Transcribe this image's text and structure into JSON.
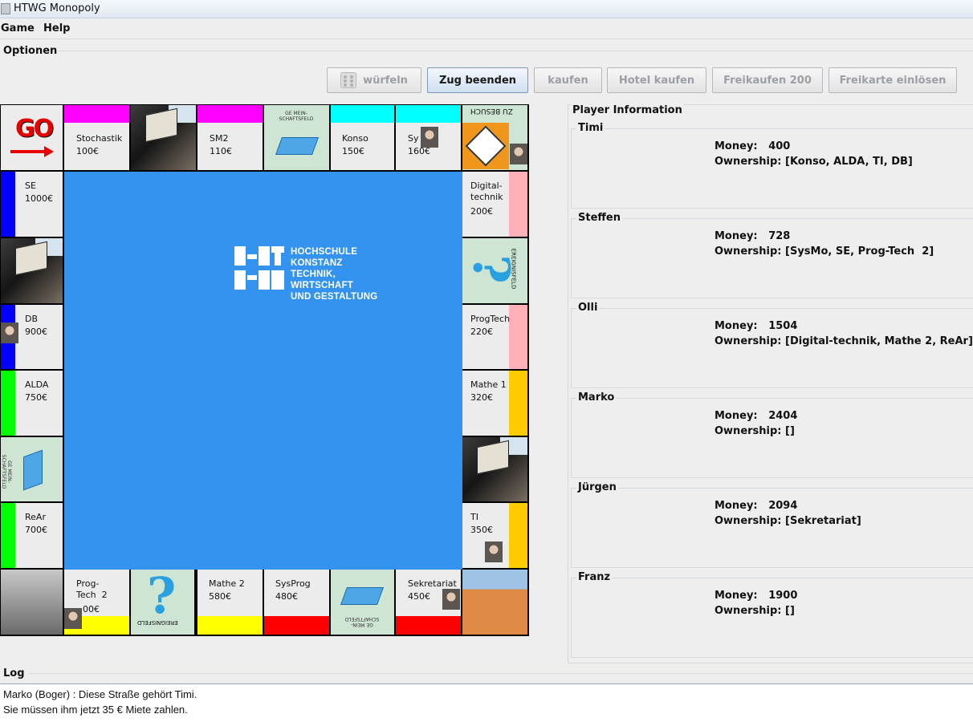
{
  "window": {
    "title": "HTWG Monopoly"
  },
  "menu": {
    "items": [
      "Game",
      "Help"
    ]
  },
  "options": {
    "label": "Optionen",
    "buttons": {
      "roll": "würfeln",
      "end_turn": "Zug beenden",
      "buy": "kaufen",
      "buy_hotel": "Hotel kaufen",
      "buy_free": "Freikaufen 200",
      "redeem_card": "Freikarte einlösen"
    }
  },
  "board": {
    "go": "GO",
    "community_label": "GE MEIN-SCHAFTSFELD",
    "chance_label": "EREIGNISFELD",
    "jail_label": "ZU BESUCH",
    "center_logo": [
      "HOCHSCHULE",
      "KONSTANZ",
      "TECHNIK, WIRTSCHAFT",
      "UND GESTALTUNG"
    ],
    "colors": {
      "center": "#3393ee",
      "magenta": "#ff00ff",
      "cyan": "#00ffff",
      "blue": "#0000ff",
      "green": "#00ff00",
      "pink": "#ffb0b8",
      "orange": "#ffcc00",
      "yellow": "#ffff00",
      "red": "#ff0000"
    },
    "top": [
      {
        "name": "Stochastik",
        "price": "100€"
      },
      {
        "name": "SM2",
        "price": "110€"
      },
      {
        "name": "Konso",
        "price": "150€"
      },
      {
        "name": "Sy",
        "price": "160€"
      }
    ],
    "left": [
      {
        "name": "SE",
        "price": "1000€"
      },
      {
        "name": "DB",
        "price": "900€"
      },
      {
        "name": "ALDA",
        "price": "750€"
      },
      {
        "name": "ReAr",
        "price": "700€"
      }
    ],
    "right": [
      {
        "name": "Digital-\ntechnik",
        "price": "200€"
      },
      {
        "name": "ProgTech",
        "price": "220€"
      },
      {
        "name": "Mathe 1",
        "price": "320€"
      },
      {
        "name": "TI",
        "price": "350€"
      }
    ],
    "bottom": [
      {
        "name": "Prog-\nTech  2",
        "price": "00€"
      },
      {
        "name": "Mathe 2",
        "price": "580€"
      },
      {
        "name": "SysProg",
        "price": "480€"
      },
      {
        "name": "Sekretariat",
        "price": "450€"
      }
    ]
  },
  "player_info": {
    "label": "Player Information",
    "players": [
      {
        "name": "Timi",
        "money": "Money:   400",
        "ownership": "Ownership: [Konso, ALDA, TI, DB]"
      },
      {
        "name": "Steffen",
        "money": "Money:   728",
        "ownership": "Ownership: [SysMo, SE, Prog-Tech  2]"
      },
      {
        "name": "Olli",
        "money": "Money:   1504",
        "ownership": "Ownership: [Digital-technik, Mathe 2, ReAr]"
      },
      {
        "name": "Marko",
        "money": "Money:   2404",
        "ownership": "Ownership: []"
      },
      {
        "name": "Jürgen",
        "money": "Money:   2094",
        "ownership": "Ownership: [Sekretariat]"
      },
      {
        "name": "Franz",
        "money": "Money:   1900",
        "ownership": "Ownership: []"
      }
    ]
  },
  "log": {
    "label": "Log",
    "lines": [
      "Marko (Boger) : Diese Straße gehört Timi.",
      "Sie müssen ihm jetzt 35 € Miete zahlen."
    ]
  }
}
